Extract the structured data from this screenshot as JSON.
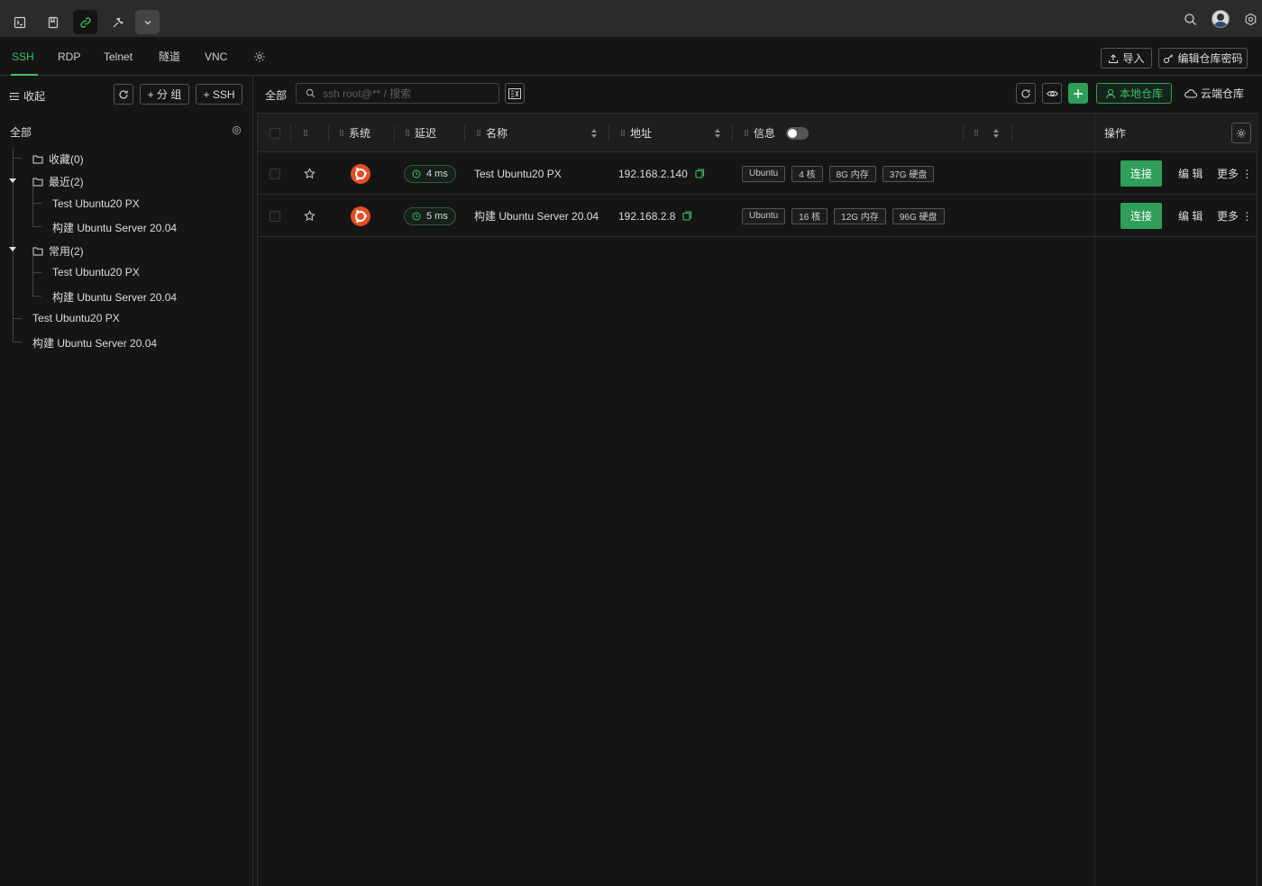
{
  "titlebar": {
    "icons": [
      "terminal-icon",
      "bookmark-icon",
      "link-icon",
      "tools-icon",
      "chevron-down-icon"
    ],
    "right_icons": [
      "search-icon",
      "avatar",
      "settings-icon"
    ]
  },
  "protocol_tabs": [
    "SSH",
    "RDP",
    "Telnet",
    "隧道",
    "VNC"
  ],
  "active_tab": "SSH",
  "header_buttons": {
    "import": "导入",
    "edit_password": "编辑仓库密码"
  },
  "sidebar": {
    "collapse": "收起",
    "add_group": "+ 分 组",
    "add_ssh": "+ SSH",
    "all": "全部",
    "tree": {
      "favorites": "收藏(0)",
      "recent": "最近(2)",
      "recent_items": [
        "Test Ubuntu20 PX",
        "构建 Ubuntu Server 20.04"
      ],
      "common": "常用(2)",
      "common_items": [
        "Test Ubuntu20 PX",
        "构建 Ubuntu Server 20.04"
      ],
      "root_items": [
        "Test Ubuntu20 PX",
        "构建 Ubuntu Server 20.04"
      ]
    }
  },
  "toolbar": {
    "all": "全部",
    "search_placeholder": "ssh root@** / 搜索",
    "local_repo": "本地仓库",
    "cloud_repo": "云端仓库"
  },
  "table": {
    "headers": {
      "system": "系统",
      "latency": "延迟",
      "name": "名称",
      "address": "地址",
      "info": "信息",
      "actions": "操作"
    },
    "rows": [
      {
        "latency": "4 ms",
        "name": "Test Ubuntu20 PX",
        "address": "192.168.2.140",
        "tags": [
          "Ubuntu",
          "4 核",
          "8G 内存",
          "37G 硬盘"
        ],
        "connect": "连接",
        "edit": "编 辑",
        "more": "更多 ⋮"
      },
      {
        "latency": "5 ms",
        "name": "构建 Ubuntu Server 20.04",
        "address": "192.168.2.8",
        "tags": [
          "Ubuntu",
          "16 核",
          "12G 内存",
          "96G 硬盘"
        ],
        "connect": "连接",
        "edit": "编 辑",
        "more": "更多 ⋮"
      }
    ]
  },
  "colors": {
    "accent": "#3fbf6a",
    "button_green": "#2f9e58",
    "ubuntu": "#e44d26",
    "background": "#151515"
  }
}
